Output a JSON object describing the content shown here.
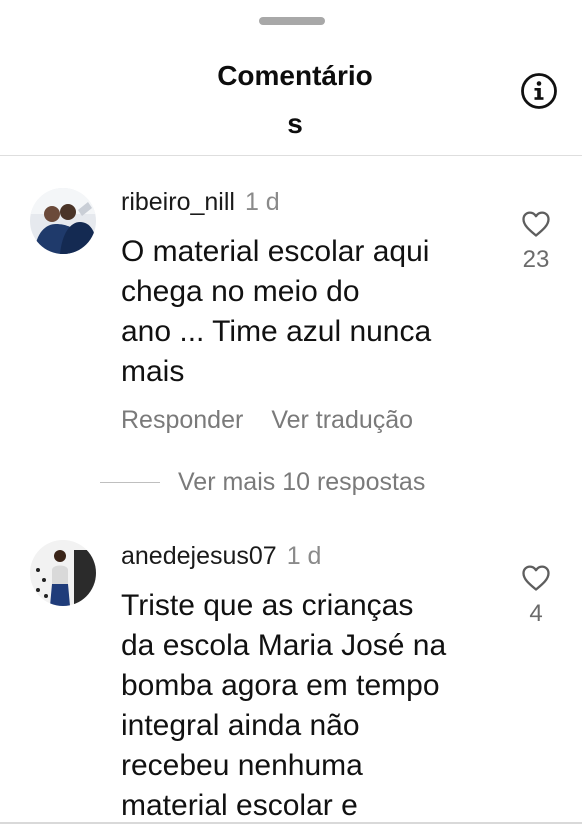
{
  "header": {
    "title_line1": "Comentário",
    "title_line2": "s",
    "info_icon": "info-icon"
  },
  "comments": [
    {
      "username": "ribeiro_nill",
      "time": "1 d",
      "text_lines": [
        "O material escolar aqui",
        "chega no meio do",
        "ano ... Time azul nunca",
        "mais"
      ],
      "like_count": "23",
      "reply_label": "Responder",
      "translate_label": "Ver tradução"
    },
    {
      "username": "anedejesus07",
      "time": "1 d",
      "text_lines": [
        "Triste que as crianças",
        "da escola Maria José na",
        "bomba agora em tempo",
        "integral ainda não",
        "recebeu nenhuma",
        "material escolar e"
      ],
      "like_count": "4"
    }
  ],
  "more_replies": "Ver mais 10 respostas",
  "colors": {
    "text": "#111111",
    "muted": "#8a8a8a",
    "divider": "#dedede"
  }
}
